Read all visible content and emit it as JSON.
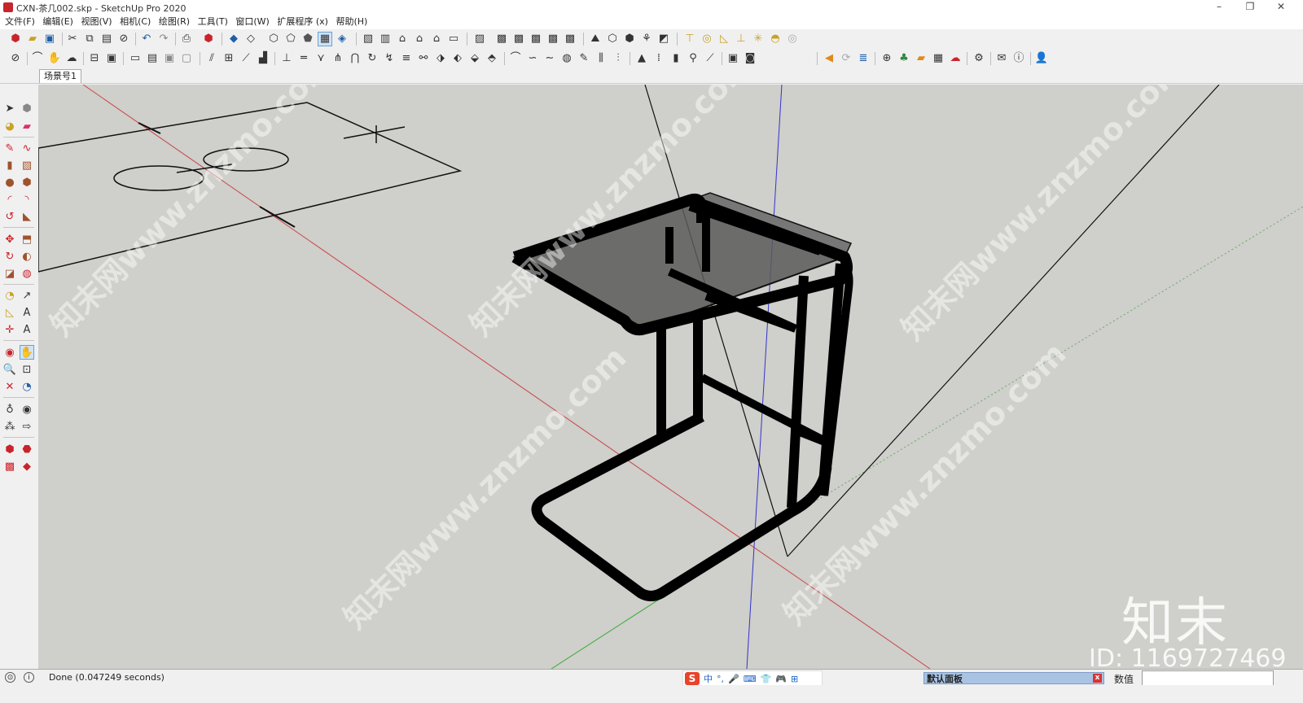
{
  "window": {
    "title": "CXN-茶几002.skp - SketchUp Pro 2020",
    "minimize": "–",
    "restore": "❐",
    "close": "✕"
  },
  "menu": [
    "文件(F)",
    "编辑(E)",
    "视图(V)",
    "相机(C)",
    "绘图(R)",
    "工具(T)",
    "窗口(W)",
    "扩展程序 (x)",
    "帮助(H)"
  ],
  "scene_tab": "场景号1",
  "viewport": {
    "watermark": "知末网www.znzmo.com",
    "logo": "知末",
    "id_text": "ID: 1169727469",
    "background": "#cfcfcb"
  },
  "status": {
    "text": "Done (0.047249 seconds)",
    "ime_items": [
      "中",
      "°,",
      "🎤",
      "⌨",
      "👕",
      "🎮",
      "⊞"
    ],
    "panel_title": "默认面板",
    "panel_close": "x",
    "measure_label": "数值"
  }
}
